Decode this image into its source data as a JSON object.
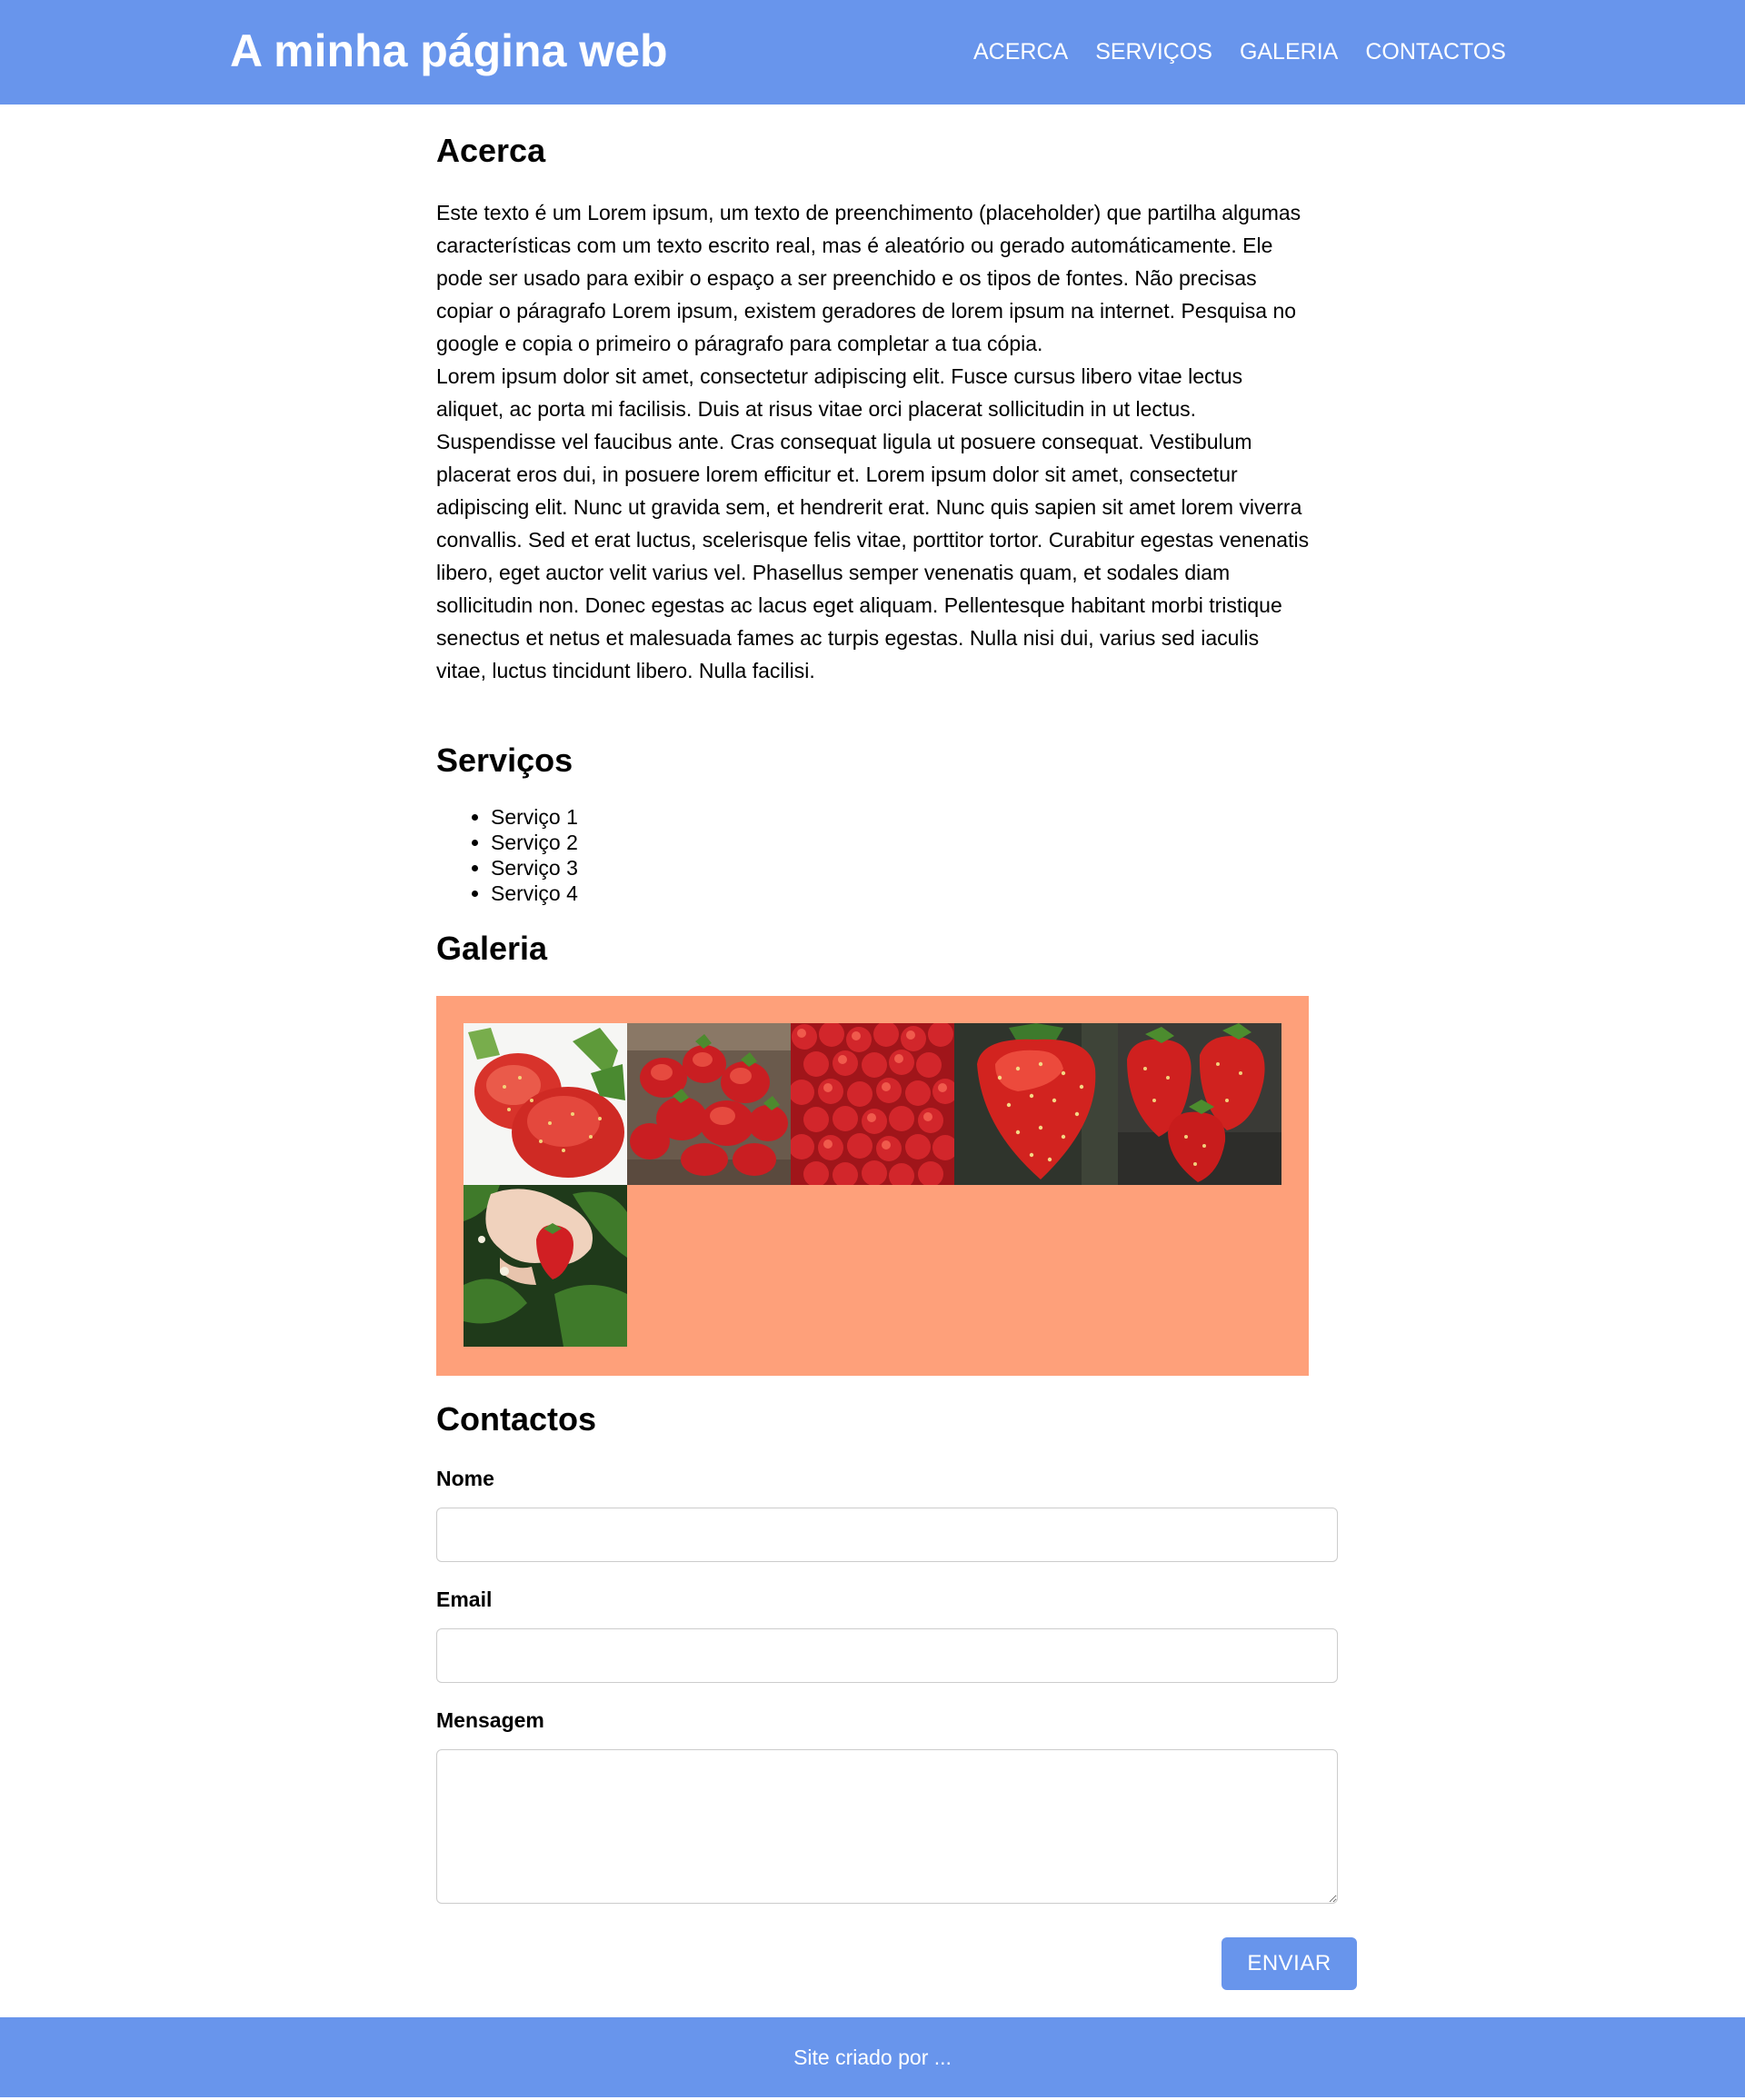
{
  "header": {
    "title": "A minha página web",
    "nav": [
      {
        "label": "ACERCA"
      },
      {
        "label": "SERVIÇOS"
      },
      {
        "label": "GALERIA"
      },
      {
        "label": "CONTACTOS"
      }
    ]
  },
  "about": {
    "heading": "Acerca",
    "paragraphs": [
      "Este texto é um Lorem ipsum, um texto de preenchimento (placeholder) que partilha algumas características com um texto escrito real, mas é aleatório ou gerado automáticamente. Ele pode ser usado para exibir o espaço a ser preenchido e os tipos de fontes. Não precisas copiar o páragrafo Lorem ipsum, existem geradores de lorem ipsum na internet. Pesquisa no google e copia o primeiro o páragrafo para completar a tua cópia.",
      "Lorem ipsum dolor sit amet, consectetur adipiscing elit. Fusce cursus libero vitae lectus aliquet, ac porta mi facilisis. Duis at risus vitae orci placerat sollicitudin in ut lectus. Suspendisse vel faucibus ante. Cras consequat ligula ut posuere consequat. Vestibulum placerat eros dui, in posuere lorem efficitur et. Lorem ipsum dolor sit amet, consectetur adipiscing elit. Nunc ut gravida sem, et hendrerit erat. Nunc quis sapien sit amet lorem viverra convallis. Sed et erat luctus, scelerisque felis vitae, porttitor tortor. Curabitur egestas venenatis libero, eget auctor velit varius vel. Phasellus semper venenatis quam, et sodales diam sollicitudin non. Donec egestas ac lacus eget aliquam. Pellentesque habitant morbi tristique senectus et netus et malesuada fames ac turpis egestas. Nulla nisi dui, varius sed iaculis vitae, luctus tincidunt libero. Nulla facilisi."
    ]
  },
  "services": {
    "heading": "Serviços",
    "items": [
      "Serviço 1",
      "Serviço 2",
      "Serviço 3",
      "Serviço 4"
    ]
  },
  "gallery": {
    "heading": "Galeria",
    "background_color": "#fea07a",
    "images": [
      {
        "name": "strawberry-photo-1"
      },
      {
        "name": "strawberry-photo-2"
      },
      {
        "name": "strawberry-photo-3"
      },
      {
        "name": "strawberry-photo-4"
      },
      {
        "name": "strawberry-photo-5"
      },
      {
        "name": "strawberry-photo-6"
      }
    ]
  },
  "contact": {
    "heading": "Contactos",
    "name_label": "Nome",
    "name_value": "",
    "email_label": "Email",
    "email_value": "",
    "message_label": "Mensagem",
    "message_value": "",
    "submit_label": "ENVIAR"
  },
  "footer": {
    "text": "Site criado por ..."
  },
  "colors": {
    "brand_blue": "#6895ec",
    "gallery_bg": "#fea07a",
    "text": "#000000"
  }
}
